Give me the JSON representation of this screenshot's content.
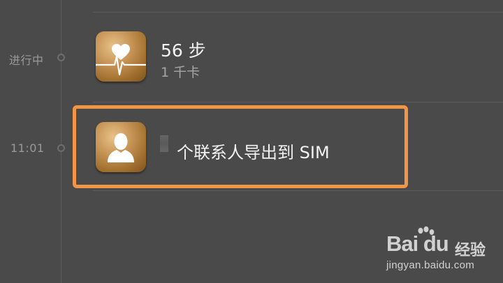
{
  "timeline": [
    {
      "time_label": "进行中",
      "icon": "heart-rate-icon",
      "title": "56 步",
      "subtitle": "1 千卡"
    },
    {
      "time_label": "11:01",
      "icon": "contact-person-icon",
      "title": "个联系人导出到 SIM",
      "highlighted": true
    }
  ],
  "watermark": {
    "logo_text": "Bai du",
    "brand_cn": "经验",
    "url": "jingyan.baidu.com"
  },
  "colors": {
    "background": "#4a4a4a",
    "highlight_border": "#f39547",
    "icon_gold": "#c9985a"
  }
}
